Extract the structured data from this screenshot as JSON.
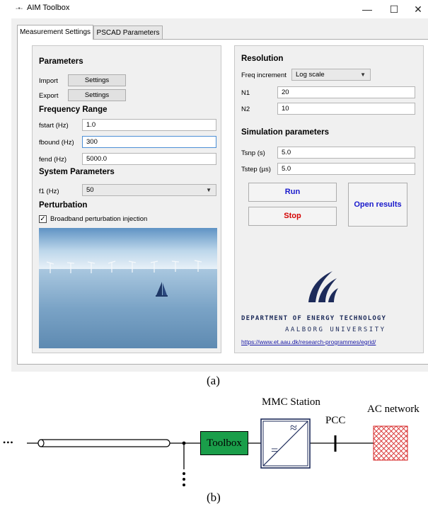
{
  "window": {
    "title": "AIM Toolbox",
    "controls": {
      "minimize": "—",
      "maximize": "☐",
      "close": "✕"
    }
  },
  "tabs": [
    {
      "label": "Measurement Settings",
      "active": true
    },
    {
      "label": "PSCAD Parameters",
      "active": false
    }
  ],
  "left_panel": {
    "parameters_heading": "Parameters",
    "import_label": "Import",
    "import_button": "Settings",
    "export_label": "Export",
    "export_button": "Settings",
    "frequency_heading": "Frequency Range",
    "fstart_label": "fstart (Hz)",
    "fstart_value": "1.0",
    "fbound_label": "fbound (Hz)",
    "fbound_value": "300",
    "fend_label": "fend (Hz)",
    "fend_value": "5000.0",
    "system_heading": "System Parameters",
    "f1_label": "f1 (Hz)",
    "f1_value": "50",
    "perturbation_heading": "Perturbation",
    "broadband_label": "Broadband perturbation injection",
    "broadband_checked": true,
    "broadband_check_glyph": "✓"
  },
  "right_panel": {
    "resolution_heading": "Resolution",
    "freq_increment_label": "Freq increment",
    "freq_increment_value": "Log scale",
    "n1_label": "N1",
    "n1_value": "20",
    "n2_label": "N2",
    "n2_value": "10",
    "simulation_heading": "Simulation parameters",
    "tsnp_label": "Tsnp (s)",
    "tsnp_value": "5.0",
    "tstep_label": "Tstep (µs)",
    "tstep_value": "5.0",
    "run_button": "Run",
    "stop_button": "Stop",
    "open_results_button": "Open results",
    "department": "DEPARTMENT OF ENERGY TECHNOLOGY",
    "university": "AALBORG UNIVERSITY",
    "link": "https://www.et.aau.dk/research-programmes/egrid/"
  },
  "colors": {
    "run_text": "#1a1acc",
    "stop_text": "#d40000",
    "open_results_text": "#1a1acc",
    "toolbox_block": "#1a9e4a",
    "mmc_block": "#1d2b5a",
    "ac_network": "#d42020"
  },
  "captions": {
    "a": "(a)",
    "b": "(b)"
  },
  "diagram": {
    "ellipsis": "•••",
    "toolbox_label": "Toolbox",
    "mmc_label": "MMC Station",
    "mmc_ac_symbol": "≈",
    "mmc_dc_symbol": "=",
    "pcc_label": "PCC",
    "ac_network_label": "AC network"
  }
}
